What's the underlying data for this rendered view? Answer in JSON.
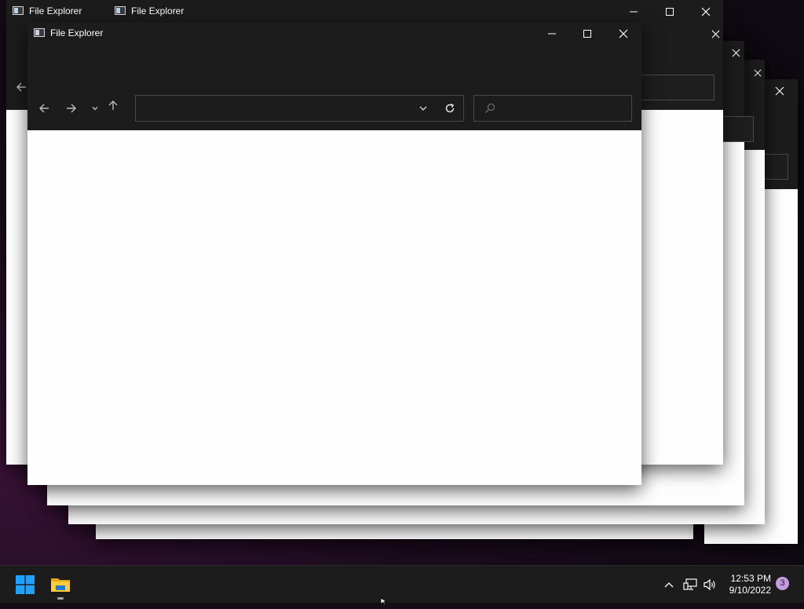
{
  "windows": [
    {
      "title": "File Explorer"
    },
    {
      "title": "File Explorer"
    },
    {
      "title": "File Explorer"
    }
  ],
  "front_window": {
    "title": "File Explorer",
    "address_value": "",
    "search_placeholder": ""
  },
  "taskbar": {
    "start_icon": "windows-logo-icon",
    "pinned": [
      {
        "name": "file-explorer",
        "running": true
      }
    ],
    "tray": {
      "time": "12:53 PM",
      "date": "9/10/2022",
      "notification_count": "3"
    }
  },
  "colors": {
    "window_chrome": "#1c1c1c",
    "window_body": "#fefefe",
    "accent_badge": "#c39be0",
    "start_blue": "#1fa2ff"
  }
}
